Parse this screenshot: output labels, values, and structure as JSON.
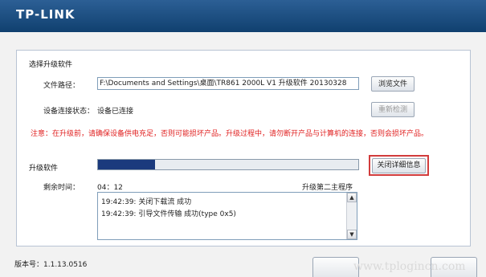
{
  "header": {
    "logo_text": "TP-LINK",
    "bg_color": "#10406f"
  },
  "upgrade": {
    "section_title": "选择升级软件",
    "file_path_label": "文件路径：",
    "file_path_value": "F:\\Documents and Settings\\桌面\\TR861 2000L V1 升级软件 20130328",
    "browse_label": "浏览文件",
    "conn_status_label": "设备连接状态：",
    "conn_status_value": "设备已连接",
    "redetect_label": "重新检测",
    "warning": "注意：在升级前，请确保设备供电充足，否则可能损坏产品。升级过程中，请勿断开产品与计算机的连接，否则会损坏产品。",
    "warning_color": "#e02020"
  },
  "progress": {
    "title": "升级软件",
    "percent": 22,
    "close_details_label": "关闭详细信息",
    "remaining_label": "剩余时间：",
    "remaining_value": "04：12",
    "stage": "升级第二主程序"
  },
  "log": {
    "lines": [
      "19:42:39: 关闭下载流 成功",
      "19:42:39: 引导文件传输 成功(type 0x5)"
    ]
  },
  "footer": {
    "version": "版本号：1.1.13.0516",
    "watermark": "www.tplogincn.com"
  }
}
